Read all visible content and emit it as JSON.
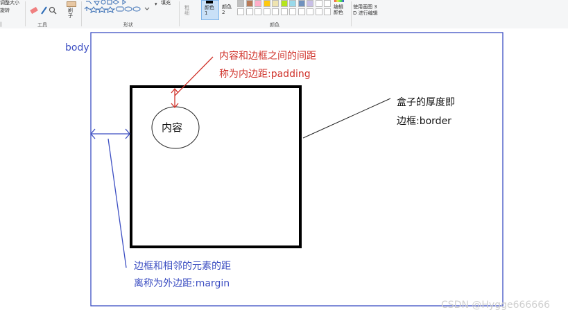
{
  "ribbon": {
    "resize_label": "调整大小",
    "rotate_label": "旋转",
    "brushes_label": "刷子",
    "tools_group": "工具",
    "shapes_group": "形状",
    "fill_label": "填充",
    "size_label": "粗细",
    "color1_label": "颜色 1",
    "color2_label": "颜色 2",
    "colors_group": "颜色",
    "edit_colors_label": "编辑颜色",
    "paint3d_line1": "使用画图 3",
    "paint3d_line2": "D 进行编辑",
    "palette": [
      "#c0c0c0",
      "#b97a57",
      "#ffaec9",
      "#ffc90e",
      "#efe4b0",
      "#b5e61d",
      "#99d9ea",
      "#7092be",
      "#c8bfe7",
      "#ffffff",
      "#ffffff"
    ],
    "color1_value": "#000000",
    "color2_value": "#ffffff"
  },
  "canvas": {
    "body_label": "body",
    "content_label": "内容",
    "padding_line1": "内容和边框之间的间距",
    "padding_line2": "称为内边距:padding",
    "border_line1": "盒子的厚度即",
    "border_line2": "边框:border",
    "margin_line1": "边框和相邻的元素的距",
    "margin_line2": "离称为外边距:margin"
  },
  "watermark": "CSDN @Hygge666666",
  "colors": {
    "body_outline": "#3c4ec2",
    "padding_note": "#d0332b",
    "border_box": "#000000"
  }
}
